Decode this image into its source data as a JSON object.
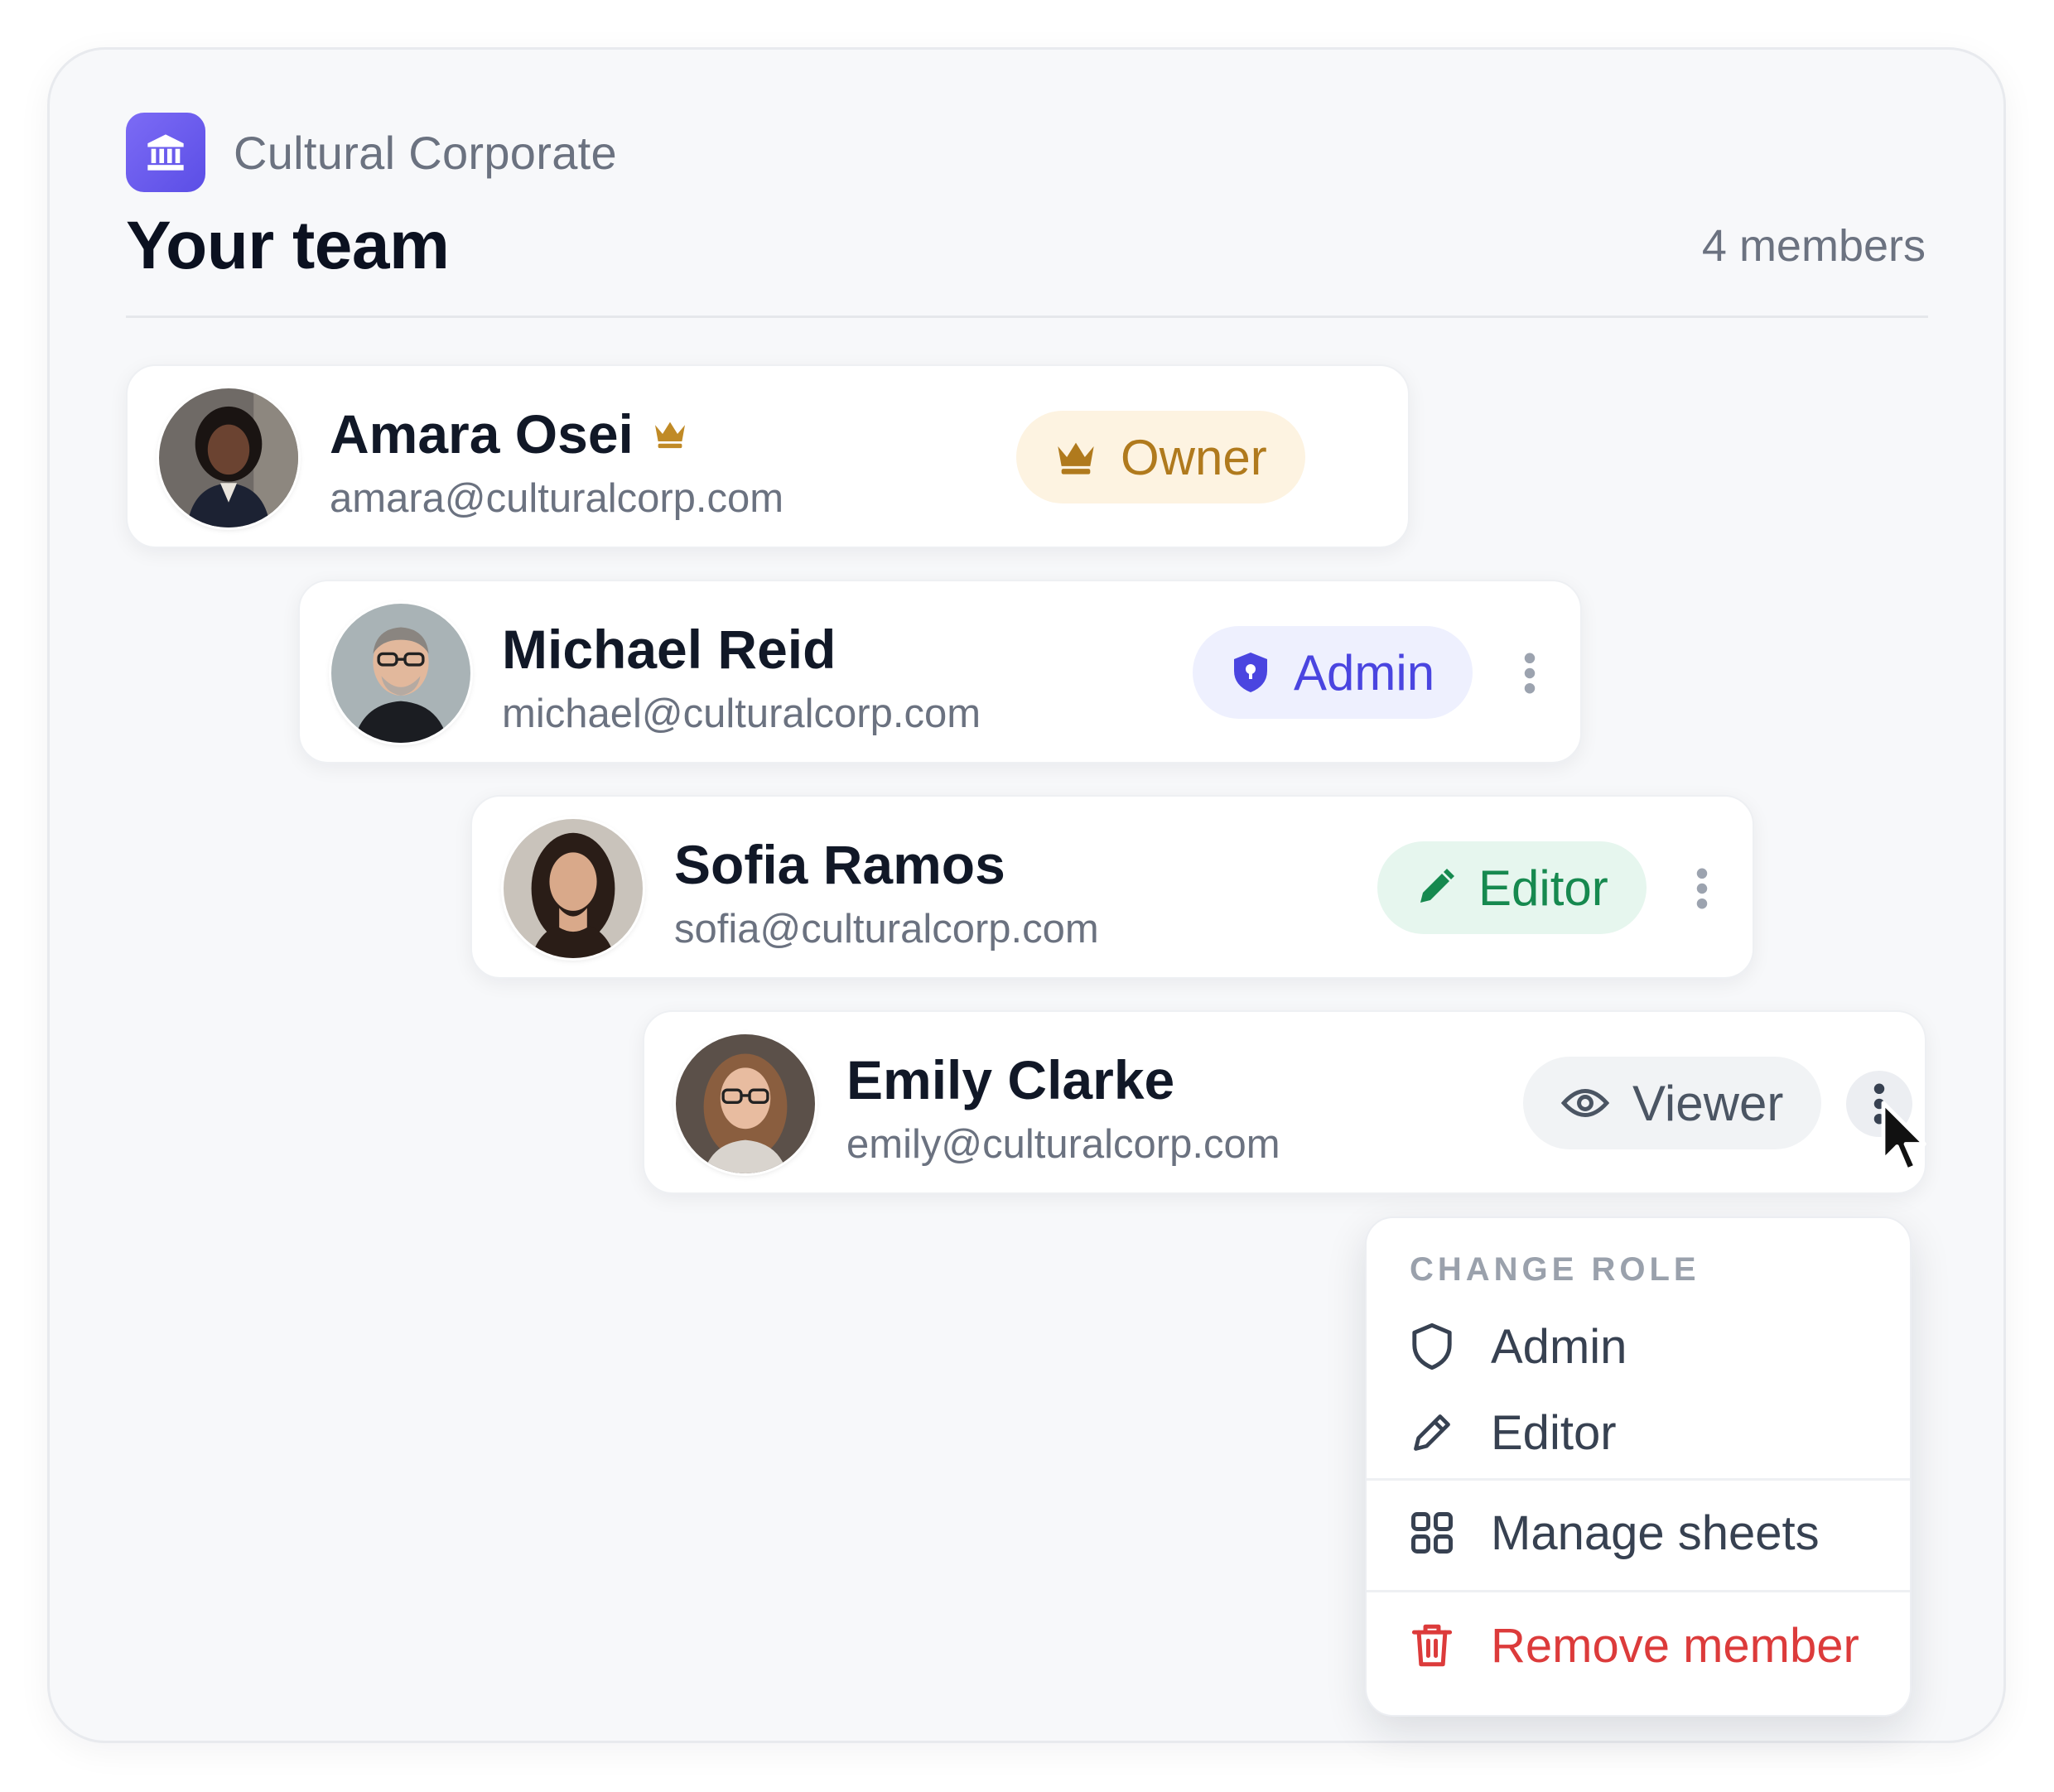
{
  "org": {
    "name": "Cultural Corporate",
    "logo_icon": "bank-icon",
    "accent": "#6c5ff0"
  },
  "page": {
    "title": "Your team",
    "member_count": "4 members"
  },
  "members": [
    {
      "name": "Amara Osei",
      "email": "amara@culturalcorp.com",
      "role": "Owner",
      "role_icon": "crown-icon",
      "is_owner": true
    },
    {
      "name": "Michael Reid",
      "email": "michael@culturalcorp.com",
      "role": "Admin",
      "role_icon": "shield-icon"
    },
    {
      "name": "Sofia Ramos",
      "email": "sofia@culturalcorp.com",
      "role": "Editor",
      "role_icon": "pencil-icon"
    },
    {
      "name": "Emily Clarke",
      "email": "emily@culturalcorp.com",
      "role": "Viewer",
      "role_icon": "eye-icon"
    }
  ],
  "menu": {
    "header": "CHANGE ROLE",
    "items": [
      {
        "label": "Admin",
        "icon": "shield-outline-icon"
      },
      {
        "label": "Editor",
        "icon": "pencil-outline-icon"
      },
      {
        "label": "Manage sheets",
        "icon": "grid-icon"
      },
      {
        "label": "Remove member",
        "icon": "trash-icon",
        "danger": true
      }
    ]
  },
  "colors": {
    "owner": "#b07a1d",
    "owner_bg": "#fdf3e1",
    "admin": "#4a45e0",
    "admin_bg": "#eef0fe",
    "editor": "#16894f",
    "editor_bg": "#e6f6ee",
    "viewer": "#4b5563",
    "viewer_bg": "#f1f3f5",
    "danger": "#dc3b3b"
  }
}
